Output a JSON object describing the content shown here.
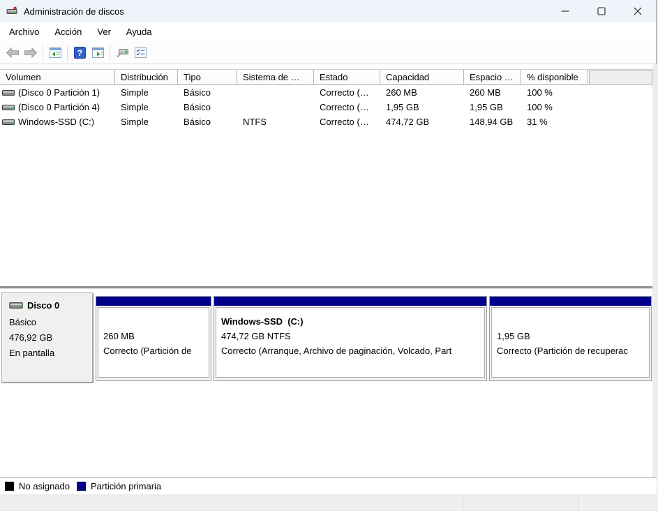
{
  "window": {
    "title": "Administración de discos"
  },
  "menu": {
    "items": [
      "Archivo",
      "Acción",
      "Ver",
      "Ayuda"
    ]
  },
  "toolbar": {
    "icons": [
      "back-icon",
      "forward-icon",
      "show-console-tree-icon",
      "help-icon",
      "show-action-pane-icon",
      "rescan-disks-icon",
      "properties-checklist-icon"
    ]
  },
  "volume_table": {
    "columns": [
      "Volumen",
      "Distribución",
      "Tipo",
      "Sistema de …",
      "Estado",
      "Capacidad",
      "Espacio …",
      "% disponible"
    ],
    "rows": [
      {
        "volume": "(Disco 0 Partición 1)",
        "layout": "Simple",
        "type": "Básico",
        "fs": "",
        "status": "Correcto (…",
        "capacity": "260 MB",
        "free": "260 MB",
        "pct": "100 %"
      },
      {
        "volume": "(Disco 0 Partición 4)",
        "layout": "Simple",
        "type": "Básico",
        "fs": "",
        "status": "Correcto (…",
        "capacity": "1,95 GB",
        "free": "1,95 GB",
        "pct": "100 %"
      },
      {
        "volume": "Windows-SSD (C:)",
        "layout": "Simple",
        "type": "Básico",
        "fs": "NTFS",
        "status": "Correcto (…",
        "capacity": "474,72 GB",
        "free": "148,94 GB",
        "pct": "31 %"
      }
    ]
  },
  "disk_panel": {
    "name": "Disco 0",
    "type": "Básico",
    "size": "476,92 GB",
    "status": "En pantalla",
    "partitions": [
      {
        "name": "",
        "size_line": "260 MB",
        "status_line": "Correcto (Partición de"
      },
      {
        "name": "Windows-SSD  (C:)",
        "size_line": "474,72 GB NTFS",
        "status_line": "Correcto (Arranque, Archivo de paginación, Volcado, Part"
      },
      {
        "name": "",
        "size_line": "1,95 GB",
        "status_line": "Correcto (Partición de recuperac"
      }
    ]
  },
  "legend": {
    "items": [
      {
        "label": "No asignado",
        "color": "#000000"
      },
      {
        "label": "Partición primaria",
        "color": "#00008c"
      }
    ]
  },
  "colors": {
    "titlebar_bg": "#eff3fa",
    "primary_partition": "#00008c",
    "unallocated": "#000000",
    "panel_gray": "#f0f0f0"
  }
}
